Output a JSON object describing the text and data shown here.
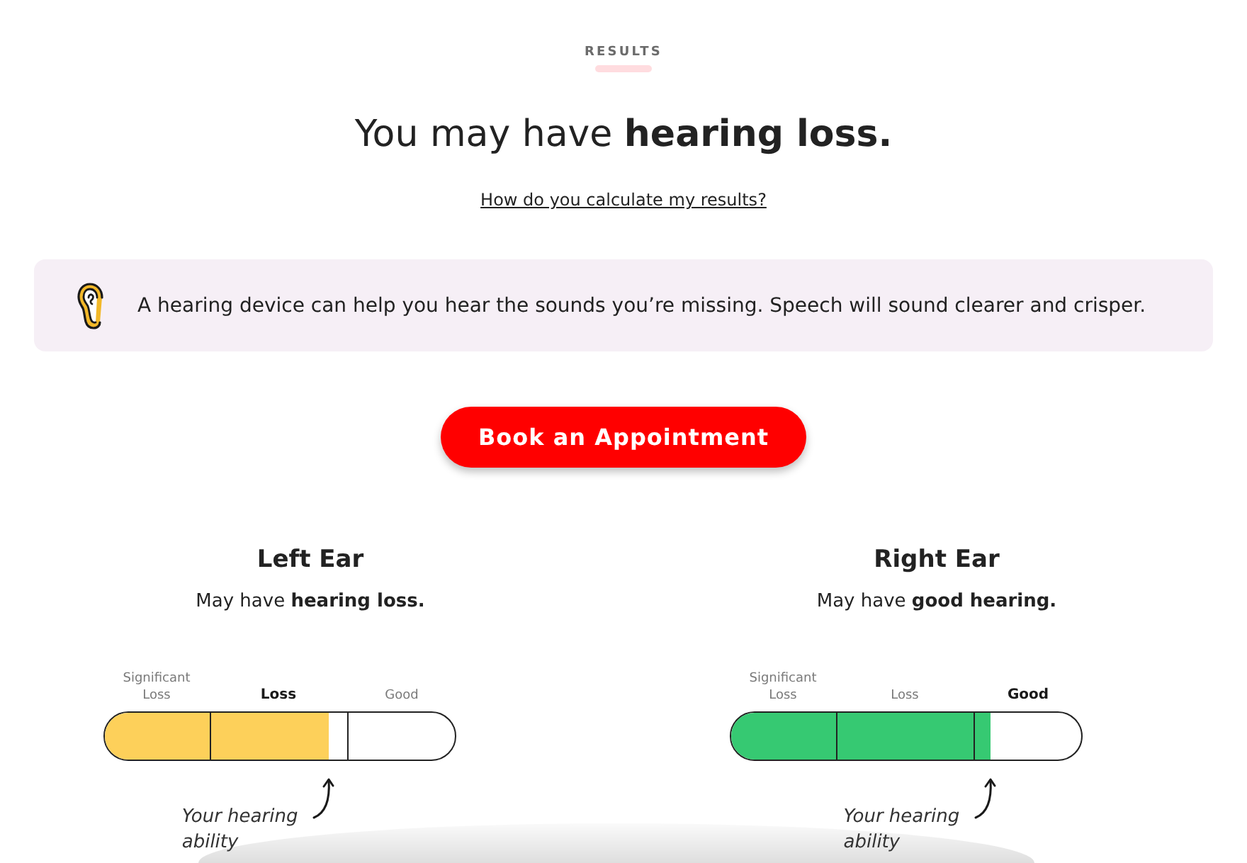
{
  "header": {
    "eyebrow": "RESULTS",
    "headline": "You may have **hearing loss.**",
    "link": "How do you calculate my results?"
  },
  "notice": {
    "text": "A hearing device can help you hear the sounds you’re missing. Speech will sound clearer and crisper."
  },
  "cta_button": "Book an Appointment",
  "ears": [
    {
      "title": "Left Ear",
      "summary": "May have **hearing loss.**",
      "meter": {
        "level": 0.64,
        "color": "#fdd05a",
        "categories": [
          {
            "label": "Significant Loss",
            "selected": false
          },
          {
            "label": "Loss",
            "selected": true
          },
          {
            "label": "Good",
            "selected": false
          }
        ],
        "pointer": "Your hearing ability"
      }
    },
    {
      "title": "Right Ear",
      "summary": "May have **good hearing.**",
      "meter": {
        "level": 0.74,
        "color": "#36c972",
        "categories": [
          {
            "label": "Significant Loss",
            "selected": false
          },
          {
            "label": "Loss",
            "selected": false
          },
          {
            "label": "Good",
            "selected": true
          }
        ],
        "pointer": "Your hearing ability"
      }
    }
  ]
}
